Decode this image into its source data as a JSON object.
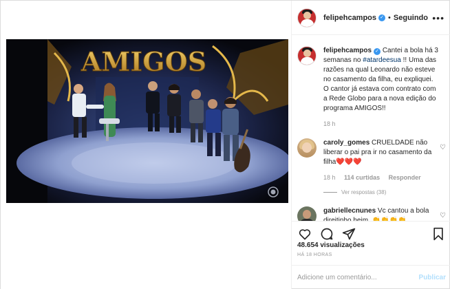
{
  "header": {
    "username": "felipehcampos",
    "separator": "•",
    "follow_label": "Seguindo",
    "more_icon": "•••"
  },
  "caption": {
    "username": "felipehcampos",
    "text_before_tag": "Cantei a bola há 3 semanas no ",
    "hashtag": "#atardeesua",
    "text_after_tag": " !! Uma das razões na qual Leonardo não esteve no casamento da filha, eu expliquei. O cantor já estava com contrato com a Rede Globo para a nova edição do programa AMIGOS!!",
    "time": "18 h"
  },
  "comments": [
    {
      "username": "caroly_gomes",
      "text": "CRUELDADE não liberar o pai pra ir no casamento da filha❤️❤️❤️",
      "time": "18 h",
      "likes": "114 curtidas",
      "reply_label": "Responder",
      "view_replies": "Ver respostas (38)"
    },
    {
      "username": "gabriellecnunes",
      "text": "Vc cantou a bola direitinho heim. 👏👏👏👏"
    }
  ],
  "actions": {
    "views": "48.654 visualizações",
    "timestamp": "HÁ 18 HORAS"
  },
  "add_comment": {
    "placeholder": "Adicione um comentário...",
    "publish_label": "Publicar"
  },
  "video": {
    "sign_text": "AMIGOS",
    "channel_logo": "globo-logo"
  },
  "colors": {
    "link": "#003569",
    "verified": "#3897f0",
    "publish_disabled": "#b2dffc",
    "muted": "#999999"
  }
}
